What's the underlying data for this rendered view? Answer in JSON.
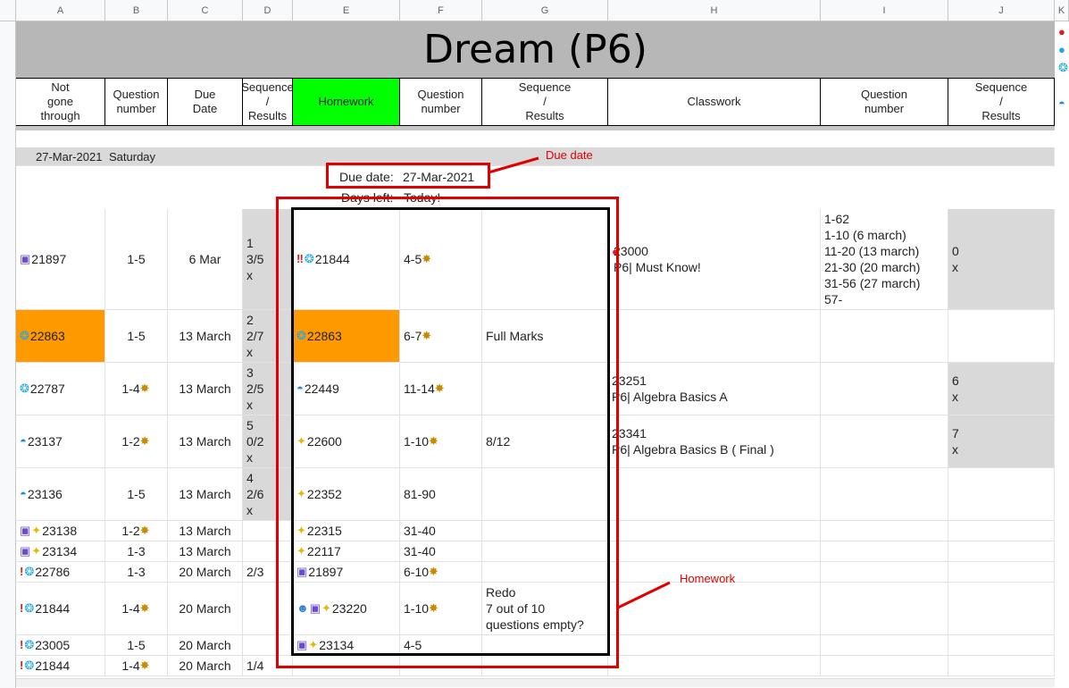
{
  "columns": [
    "A",
    "B",
    "C",
    "D",
    "E",
    "F",
    "G",
    "H",
    "I",
    "J",
    "K"
  ],
  "sheet_title": "Dream (P6)",
  "headers": {
    "not_gone_through": "Not\ngone\nthrough",
    "question_number": "Question\nnumber",
    "due_date": "Due\nDate",
    "sequence_results": "Sequence\n/\nResults",
    "homework": "Homework",
    "hw_question_number": "Question\nnumber",
    "hw_sequence_results": "Sequence\n/\nResults",
    "classwork": "Classwork",
    "cw_question_number": "Question\nnumber",
    "cw_sequence_results": "Sequence\n/\nResults"
  },
  "date_row": {
    "date": "27-Mar-2021",
    "day": "Saturday"
  },
  "due_info": {
    "due_label": "Due date:",
    "due_value": "27-Mar-2021",
    "days_left_label": "Days left:",
    "days_left_value": "Today!"
  },
  "rows": [
    {
      "a": "21897",
      "b": "1-5",
      "c": "6 Mar",
      "d": "1\n3/5\nx",
      "e": "21844",
      "f": "4-5",
      "g": "",
      "h": "23000\nP6| Must Know!",
      "i": "1-62\n1-10 (6 march)\n11-20 (13 march)\n21-30 (20 march)\n31-56 (27 march)\n57-",
      "j": "0\nx"
    },
    {
      "a": "22863",
      "b": "1-5",
      "c": "13 March",
      "d": "2\n2/7\nx",
      "e": "22863",
      "f": "6-7",
      "g": "Full Marks",
      "h": "",
      "i": "",
      "j": ""
    },
    {
      "a": "22787",
      "b": "1-4",
      "c": "13 March",
      "d": "3\n2/5\nx",
      "e": "22449",
      "f": "11-14",
      "g": "",
      "h": "23251\nP6| Algebra Basics A",
      "i": "",
      "j": "6\nx"
    },
    {
      "a": "23137",
      "b": "1-2",
      "c": "13 March",
      "d": "5\n0/2\nx",
      "e": "22600",
      "f": "1-10",
      "g": "8/12",
      "h": "23341\nP6| Algebra Basics B ( Final )",
      "i": "",
      "j": "7\nx"
    },
    {
      "a": "23136",
      "b": "1-5",
      "c": "13 March",
      "d": "4\n2/6\nx",
      "e": "22352",
      "f": "81-90",
      "g": "",
      "h": "",
      "i": "",
      "j": ""
    },
    {
      "a": "23138",
      "b": "1-2",
      "c": "13 March",
      "d": "",
      "e": "22315",
      "f": "31-40",
      "g": "",
      "h": "",
      "i": "",
      "j": ""
    },
    {
      "a": "23134",
      "b": "1-3",
      "c": "13 March",
      "d": "",
      "e": "22117",
      "f": "31-40",
      "g": "",
      "h": "",
      "i": "",
      "j": ""
    },
    {
      "a": "22786",
      "b": "1-3",
      "c": "20 March",
      "d": "2/3",
      "e": "21897",
      "f": "6-10",
      "g": "",
      "h": "",
      "i": "",
      "j": ""
    },
    {
      "a": "21844",
      "b": "1-4",
      "c": "20 March",
      "d": "",
      "e": "23220",
      "f": "1-10",
      "g": "Redo\n7 out of 10\nquestions empty?",
      "h": "",
      "i": "",
      "j": ""
    },
    {
      "a": "23005",
      "b": "1-5",
      "c": "20 March",
      "d": "",
      "e": "23134",
      "f": "4-5",
      "g": "",
      "h": "",
      "i": "",
      "j": ""
    },
    {
      "a": "21844",
      "b": "1-4",
      "c": "20 March",
      "d": "1/4",
      "e": "",
      "f": "",
      "g": "",
      "h": "",
      "i": "",
      "j": ""
    }
  ],
  "annotations": {
    "due_date": "Due date",
    "homework": "Homework"
  },
  "colors": {
    "accent_red": "#e00000",
    "orange": "#ff9900",
    "homework_green": "#00ff00",
    "gray": "#d9d9d9"
  }
}
